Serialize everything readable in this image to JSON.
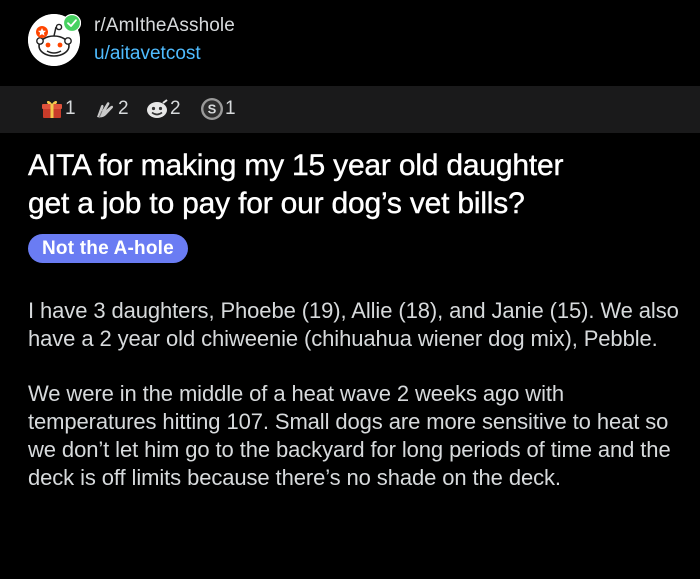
{
  "post": {
    "subreddit": "r/AmItheAsshole",
    "author": "u/aitavetcost",
    "title_lines": [
      "AITA for making my 15 year old daughter",
      "get a job to pay for our dog’s vet bills?"
    ],
    "flair": "Not the A-hole",
    "flair_color": "#6a7cf3",
    "paragraphs": [
      "I have 3 daughters, Phoebe (19), Allie (18), and Janie (15). We also have a 2 year old chiweenie (chihuahua wiener dog mix), Pebble.",
      "We were in the middle of a heat wave 2 weeks ago with temperatures hitting 107. Small dogs are more sensitive to heat so we don’t let him go to the backyard for long periods of time and the deck is off limits because there’s no shade on the deck."
    ]
  },
  "awards": [
    {
      "icon": "gift-award-icon",
      "count": "1"
    },
    {
      "icon": "hands-award-icon",
      "count": "2"
    },
    {
      "icon": "face-award-icon",
      "count": "2"
    },
    {
      "icon": "silver-s-award-icon",
      "count": "1"
    }
  ],
  "colors": {
    "background": "#000000",
    "award_bar": "#1a1a1b",
    "username_link": "#4fbcff",
    "text": "#d7dadc",
    "title": "#ffffff"
  }
}
